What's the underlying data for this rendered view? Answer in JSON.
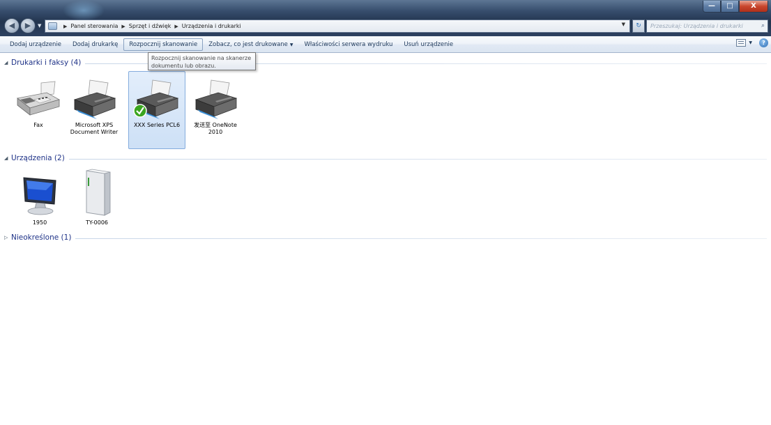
{
  "window": {
    "controls": {
      "minimize": "—",
      "maximize": "□",
      "close": "X"
    }
  },
  "navigation": {
    "back": "◀",
    "forward": "▶"
  },
  "address": {
    "breadcrumbs": [
      "Panel sterowania",
      "Sprzęt i dźwięk",
      "Urządzenia i drukarki"
    ],
    "separator": "▶"
  },
  "search": {
    "placeholder": "Przeszukaj: Urządzenia i drukarki"
  },
  "commands": [
    {
      "label": "Dodaj urządzenie"
    },
    {
      "label": "Dodaj drukarkę"
    },
    {
      "label": "Rozpocznij skanowanie",
      "active": true
    },
    {
      "label": "Zobacz, co jest drukowane",
      "has_dropdown": true
    },
    {
      "label": "Właściwości serwera wydruku"
    },
    {
      "label": "Usuń urządzenie"
    }
  ],
  "tooltip": {
    "text": "Rozpocznij skanowanie na skanerze dokumentu lub obrazu."
  },
  "groups": {
    "printers": {
      "title": "Drukarki i faksy (4)",
      "expanded": true
    },
    "devices": {
      "title": "Urządzenia (2)",
      "expanded": true
    },
    "unspecified": {
      "title": "Nieokreślone (1)",
      "expanded": false
    }
  },
  "printers": [
    {
      "name": "Fax",
      "icon": "fax-icon"
    },
    {
      "name": "Microsoft XPS Document Writer",
      "icon": "printer-icon"
    },
    {
      "name": "XXX Series PCL6",
      "icon": "printer-icon",
      "default": true,
      "selected": true
    },
    {
      "name": "发送至 OneNote 2010",
      "icon": "printer-icon"
    }
  ],
  "devices": [
    {
      "name": "1950",
      "icon": "monitor-icon"
    },
    {
      "name": "TY-0006",
      "icon": "external-drive-icon"
    }
  ],
  "colors": {
    "title_bar": "#2d4160",
    "group_title": "#1e3287",
    "selection": "#cde0f6",
    "check_badge": "#3aa51f"
  }
}
